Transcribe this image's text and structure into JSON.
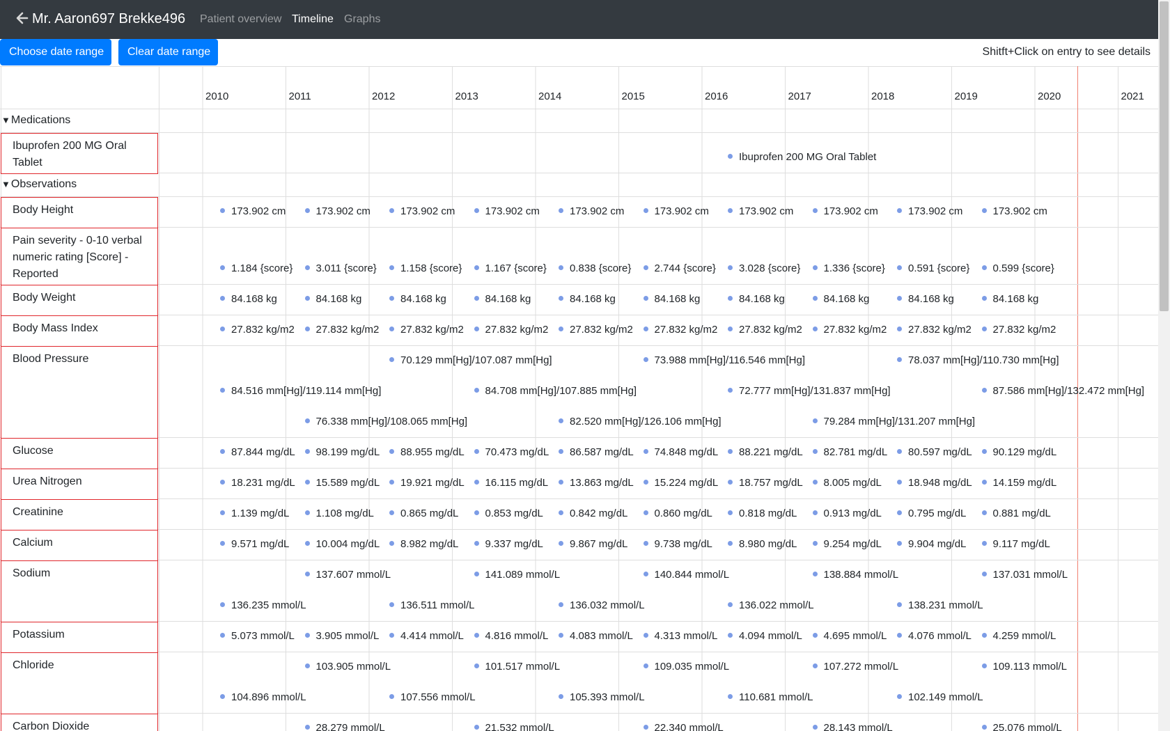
{
  "header": {
    "patient_name": "Mr. Aaron697 Brekke496",
    "nav": [
      "Patient overview",
      "Timeline",
      "Graphs"
    ],
    "active": "Timeline"
  },
  "toolbar": {
    "choose_label": "Choose date range",
    "clear_label": "Clear date range",
    "hint": "Shitft+Click on entry to see details"
  },
  "years": [
    "2010",
    "2011",
    "2012",
    "2013",
    "2014",
    "2015",
    "2016",
    "2017",
    "2018",
    "2019",
    "2020",
    "2021"
  ],
  "groups": [
    {
      "label": "Medications"
    },
    {
      "label": "Observations"
    }
  ],
  "rows": [
    {
      "label": "Ibuprofen 200 MG Oral Tablet",
      "group": 0,
      "lines": [
        [
          null,
          null,
          null,
          null,
          null,
          null,
          "Ibuprofen 200 MG Oral Tablet",
          null,
          null,
          null
        ]
      ]
    },
    {
      "label": "Body Height",
      "group": 1,
      "lines": [
        [
          "173.902 cm",
          "173.902 cm",
          "173.902 cm",
          "173.902 cm",
          "173.902 cm",
          "173.902 cm",
          "173.902 cm",
          "173.902 cm",
          "173.902 cm",
          "173.902 cm"
        ]
      ]
    },
    {
      "label": "Pain severity - 0-10 verbal numeric rating [Score] - Reported",
      "group": 1,
      "lines": [
        [
          "1.184 {score}",
          "3.011 {score}",
          "1.158 {score}",
          "1.167 {score}",
          "0.838 {score}",
          "2.744 {score}",
          "3.028 {score}",
          "1.336 {score}",
          "0.591 {score}",
          "0.599 {score}"
        ]
      ]
    },
    {
      "label": "Body Weight",
      "group": 1,
      "lines": [
        [
          "84.168 kg",
          "84.168 kg",
          "84.168 kg",
          "84.168 kg",
          "84.168 kg",
          "84.168 kg",
          "84.168 kg",
          "84.168 kg",
          "84.168 kg",
          "84.168 kg"
        ]
      ]
    },
    {
      "label": "Body Mass Index",
      "group": 1,
      "lines": [
        [
          "27.832 kg/m2",
          "27.832 kg/m2",
          "27.832 kg/m2",
          "27.832 kg/m2",
          "27.832 kg/m2",
          "27.832 kg/m2",
          "27.832 kg/m2",
          "27.832 kg/m2",
          "27.832 kg/m2",
          "27.832 kg/m2"
        ]
      ]
    },
    {
      "label": "Blood Pressure",
      "group": 1,
      "lines": [
        [
          null,
          null,
          "70.129 mm[Hg]/107.087 mm[Hg]",
          null,
          null,
          "73.988 mm[Hg]/116.546 mm[Hg]",
          null,
          null,
          "78.037 mm[Hg]/110.730 mm[Hg]",
          null
        ],
        [
          "84.516 mm[Hg]/119.114 mm[Hg]",
          null,
          null,
          "84.708 mm[Hg]/107.885 mm[Hg]",
          null,
          null,
          "72.777 mm[Hg]/131.837 mm[Hg]",
          null,
          null,
          "87.586 mm[Hg]/132.472 mm[Hg]"
        ],
        [
          null,
          "76.338 mm[Hg]/108.065 mm[Hg]",
          null,
          null,
          "82.520 mm[Hg]/126.106 mm[Hg]",
          null,
          null,
          "79.284 mm[Hg]/131.207 mm[Hg]",
          null,
          null
        ]
      ]
    },
    {
      "label": "Glucose",
      "group": 1,
      "lines": [
        [
          "87.844 mg/dL",
          "98.199 mg/dL",
          "88.955 mg/dL",
          "70.473 mg/dL",
          "86.587 mg/dL",
          "74.848 mg/dL",
          "88.221 mg/dL",
          "82.781 mg/dL",
          "80.597 mg/dL",
          "90.129 mg/dL"
        ]
      ]
    },
    {
      "label": "Urea Nitrogen",
      "group": 1,
      "lines": [
        [
          "18.231 mg/dL",
          "15.589 mg/dL",
          "19.921 mg/dL",
          "16.115 mg/dL",
          "13.863 mg/dL",
          "15.224 mg/dL",
          "18.757 mg/dL",
          "8.005 mg/dL",
          "18.948 mg/dL",
          "14.159 mg/dL"
        ]
      ]
    },
    {
      "label": "Creatinine",
      "group": 1,
      "lines": [
        [
          "1.139 mg/dL",
          "1.108 mg/dL",
          "0.865 mg/dL",
          "0.853 mg/dL",
          "0.842 mg/dL",
          "0.860 mg/dL",
          "0.818 mg/dL",
          "0.913 mg/dL",
          "0.795 mg/dL",
          "0.881 mg/dL"
        ]
      ]
    },
    {
      "label": "Calcium",
      "group": 1,
      "lines": [
        [
          "9.571 mg/dL",
          "10.004 mg/dL",
          "8.982 mg/dL",
          "9.337 mg/dL",
          "9.867 mg/dL",
          "9.738 mg/dL",
          "8.980 mg/dL",
          "9.254 mg/dL",
          "9.904 mg/dL",
          "9.117 mg/dL"
        ]
      ]
    },
    {
      "label": "Sodium",
      "group": 1,
      "lines": [
        [
          null,
          "137.607 mmol/L",
          null,
          "141.089 mmol/L",
          null,
          "140.844 mmol/L",
          null,
          "138.884 mmol/L",
          null,
          "137.031 mmol/L"
        ],
        [
          "136.235 mmol/L",
          null,
          "136.511 mmol/L",
          null,
          "136.032 mmol/L",
          null,
          "136.022 mmol/L",
          null,
          "138.231 mmol/L",
          null
        ]
      ]
    },
    {
      "label": "Potassium",
      "group": 1,
      "lines": [
        [
          "5.073 mmol/L",
          "3.905 mmol/L",
          "4.414 mmol/L",
          "4.816 mmol/L",
          "4.083 mmol/L",
          "4.313 mmol/L",
          "4.094 mmol/L",
          "4.695 mmol/L",
          "4.076 mmol/L",
          "4.259 mmol/L"
        ]
      ]
    },
    {
      "label": "Chloride",
      "group": 1,
      "lines": [
        [
          null,
          "103.905 mmol/L",
          null,
          "101.517 mmol/L",
          null,
          "109.035 mmol/L",
          null,
          "107.272 mmol/L",
          null,
          "109.113 mmol/L"
        ],
        [
          "104.896 mmol/L",
          null,
          "107.556 mmol/L",
          null,
          "105.393 mmol/L",
          null,
          "110.681 mmol/L",
          null,
          "102.149 mmol/L",
          null
        ]
      ]
    },
    {
      "label": "Carbon Dioxide",
      "group": 1,
      "lines": [
        [
          null,
          "28.279 mmol/L",
          null,
          "21.532 mmol/L",
          null,
          "22.340 mmol/L",
          null,
          "28.143 mmol/L",
          null,
          "25.076 mmol/L"
        ]
      ]
    }
  ],
  "colors": {
    "navbar": "#343a40",
    "primary": "#007bff",
    "row_border": "#e0262b",
    "dot": "#7c9ce6",
    "grid": "#dedede",
    "today_line": "#f08070"
  },
  "icons": {
    "back": "arrow-left-icon",
    "expand": "triangle-down-icon",
    "bullet": "dot-icon"
  }
}
